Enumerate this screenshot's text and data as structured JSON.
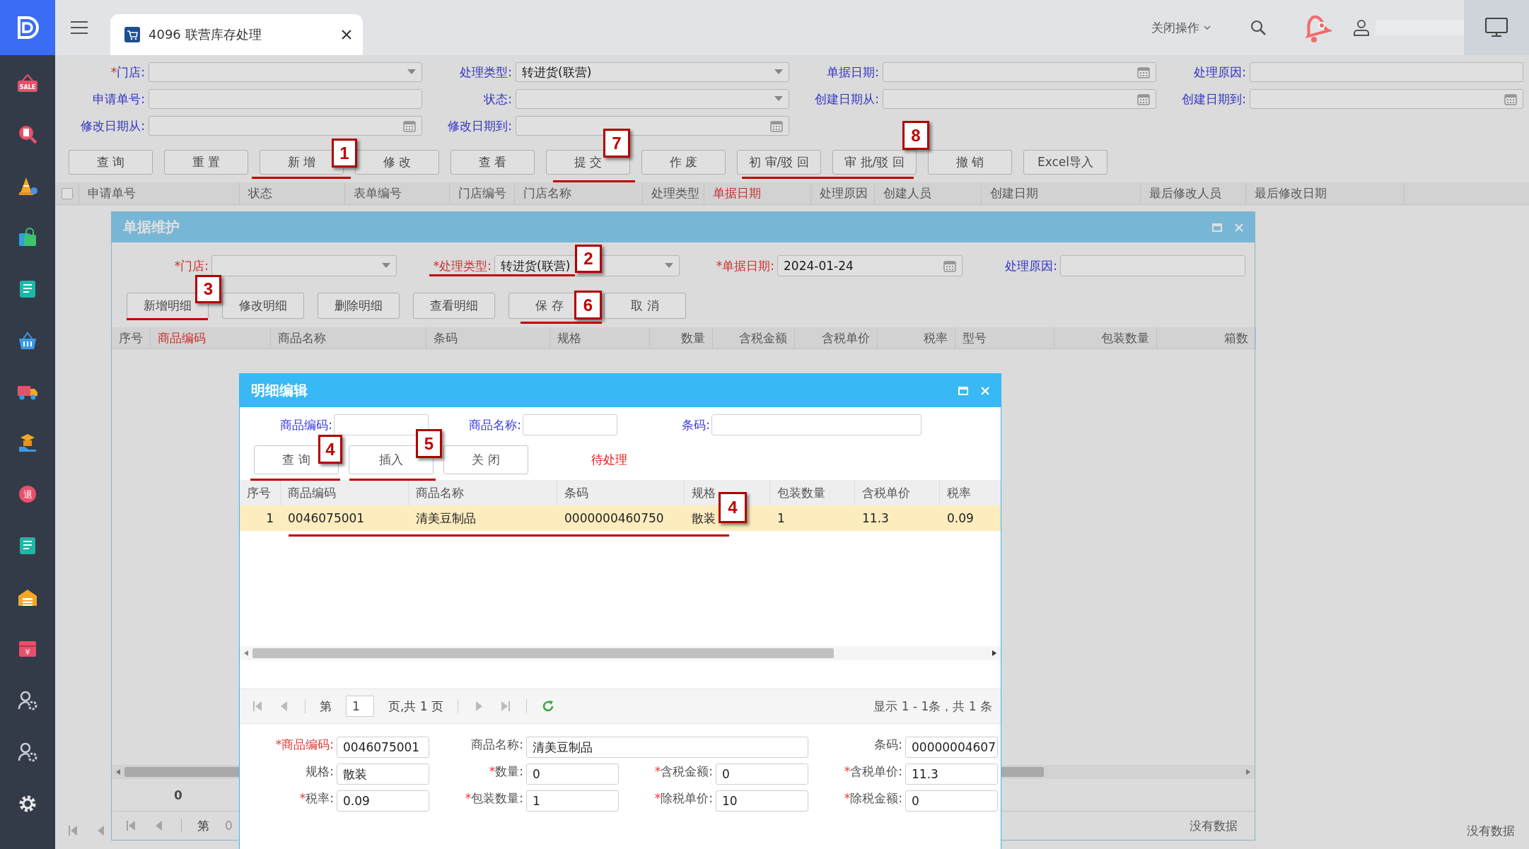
{
  "sidebar": [
    {
      "kind": "sale",
      "glyph": "SALE"
    },
    {
      "kind": "search-doc"
    },
    {
      "kind": "cone"
    },
    {
      "kind": "bag"
    },
    {
      "kind": "book"
    },
    {
      "kind": "basket"
    },
    {
      "kind": "truck"
    },
    {
      "kind": "hand-box"
    },
    {
      "kind": "badge",
      "glyph": "退"
    },
    {
      "kind": "book"
    },
    {
      "kind": "house"
    },
    {
      "kind": "money-box",
      "glyph": "¥"
    },
    {
      "kind": "user-gear"
    },
    {
      "kind": "user-gear"
    },
    {
      "kind": "gear"
    }
  ],
  "header": {
    "tab_title": "4096 联营库存处理",
    "close_menu": "关闭操作"
  },
  "filters": [
    {
      "label": "门店:",
      "mark": "*",
      "alert": false,
      "accent": true,
      "kind": "select"
    },
    {
      "label": "处理类型:",
      "alert": false,
      "accent": true,
      "kind": "select",
      "value": "转进货(联营)"
    },
    {
      "label": "单据日期:",
      "alert": false,
      "accent": true,
      "kind": "date"
    },
    {
      "label": "处理原因:",
      "alert": false,
      "accent": true,
      "kind": "text"
    },
    {
      "label": "申请单号:",
      "alert": false,
      "accent": true,
      "kind": "text"
    },
    {
      "label": "状态:",
      "alert": false,
      "accent": true,
      "kind": "select"
    },
    {
      "label": "创建日期从:",
      "alert": false,
      "accent": true,
      "kind": "date"
    },
    {
      "label": "创建日期到:",
      "alert": false,
      "accent": true,
      "kind": "date"
    },
    {
      "label": "修改日期从:",
      "alert": false,
      "accent": true,
      "kind": "date"
    },
    {
      "label": "修改日期到:",
      "alert": false,
      "accent": true,
      "kind": "date"
    }
  ],
  "toolbar": [
    "查 询",
    "重 置",
    "新 增",
    "修 改",
    "查 看",
    "提 交",
    "作 废",
    "初 审/驳 回",
    "审 批/驳 回",
    "撤 销",
    "Excel导入"
  ],
  "table": {
    "select_all": {
      "checked": false
    },
    "columns": [
      {
        "label": "申请单号",
        "highlight": false
      },
      {
        "label": "状态",
        "highlight": false
      },
      {
        "label": "表单编号",
        "highlight": false
      },
      {
        "label": "门店编号",
        "highlight": false
      },
      {
        "label": "门店名称",
        "highlight": false
      },
      {
        "label": "处理类型",
        "highlight": false
      },
      {
        "label": "单据日期",
        "highlight": true
      },
      {
        "label": "处理原因",
        "highlight": false
      },
      {
        "label": "创建人员",
        "highlight": false
      },
      {
        "label": "创建日期",
        "highlight": false
      },
      {
        "label": "最后修改人员",
        "highlight": false
      },
      {
        "label": "最后修改日期",
        "highlight": false
      }
    ]
  },
  "pager": {
    "empty_text": "没有数据"
  },
  "order_dialog": {
    "title": "单据维护",
    "fields": [
      {
        "label": "门店:",
        "mark": "*",
        "alert": true,
        "kind": "select"
      },
      {
        "label": "处理类型:",
        "mark": "*",
        "alert": true,
        "kind": "select",
        "value": "转进货(联营)"
      },
      {
        "label": "单据日期:",
        "mark": "*",
        "alert": true,
        "kind": "date",
        "value": "2024-01-24"
      },
      {
        "label": "处理原因:",
        "alert": false,
        "accent": true,
        "kind": "text"
      }
    ],
    "buttons": [
      "新增明细",
      "修改明细",
      "删除明细",
      "查看明细",
      "保 存",
      "取 消"
    ],
    "columns": [
      {
        "label": "序号",
        "highlight": false
      },
      {
        "label": "商品编码",
        "highlight": true
      },
      {
        "label": "商品名称",
        "highlight": false
      },
      {
        "label": "条码",
        "highlight": false
      },
      {
        "label": "规格",
        "highlight": false
      },
      {
        "label": "数量",
        "highlight": false
      },
      {
        "label": "含税金额",
        "highlight": false
      },
      {
        "label": "含税单价",
        "highlight": false
      },
      {
        "label": "税率",
        "highlight": false
      },
      {
        "label": "型号",
        "highlight": false
      },
      {
        "label": "包装数量",
        "highlight": false
      },
      {
        "label": "箱数",
        "highlight": false
      }
    ],
    "summary_value": "0",
    "pager": {
      "page_label": "第",
      "page": "0",
      "empty_text": "没有数据"
    }
  },
  "detail_dialog": {
    "title": "明细编辑",
    "search": [
      {
        "label": "商品编码:",
        "alert": false,
        "accent": true,
        "kind": "text"
      },
      {
        "label": "商品名称:",
        "alert": false,
        "accent": true,
        "kind": "text"
      },
      {
        "label": "条码:",
        "alert": false,
        "accent": true,
        "kind": "text"
      }
    ],
    "buttons": [
      "查 询",
      "插入",
      "关 闭"
    ],
    "status": "待处理",
    "columns": [
      "序号",
      "商品编码",
      "商品名称",
      "条码",
      "规格",
      "包装数量",
      "含税单价",
      "税率"
    ],
    "rows": [
      {
        "selected": true,
        "cells": [
          "1",
          "0046075001",
          "清美豆制品",
          "0000000460750",
          "散装",
          "1",
          "11.3",
          "0.09"
        ]
      }
    ],
    "pager": {
      "page_label": "第",
      "page": "1",
      "page_total": "页,共 1 页",
      "summary": "显示 1 - 1条，共 1 条"
    },
    "form": [
      {
        "label": "商品编码:",
        "mark": "*",
        "alert": true,
        "kind": "text",
        "value": "0046075001"
      },
      {
        "label": "商品名称:",
        "alert": false,
        "accent": false,
        "kind": "text",
        "value": "清美豆制品"
      },
      {
        "label": "条码:",
        "alert": false,
        "accent": false,
        "kind": "text",
        "value": "00000004607"
      },
      {
        "label": "规格:",
        "alert": false,
        "accent": false,
        "kind": "text",
        "value": "散装"
      },
      {
        "label": "数量:",
        "mark": "*",
        "alert": false,
        "accent": false,
        "kind": "text",
        "value": "0"
      },
      {
        "label": "含税金额:",
        "mark": "*",
        "alert": false,
        "accent": false,
        "kind": "text",
        "value": "0"
      },
      {
        "label": "含税单价:",
        "mark": "*",
        "alert": false,
        "accent": false,
        "kind": "text",
        "value": "11.3"
      },
      {
        "label": "税率:",
        "mark": "*",
        "alert": false,
        "accent": false,
        "kind": "text",
        "value": "0.09"
      },
      {
        "label": "包装数量:",
        "mark": "*",
        "alert": false,
        "accent": false,
        "kind": "text",
        "value": "1"
      },
      {
        "label": "除税单价:",
        "mark": "*",
        "alert": false,
        "accent": false,
        "kind": "text",
        "value": "10"
      },
      {
        "label": "除税金额:",
        "mark": "*",
        "alert": false,
        "accent": false,
        "kind": "text",
        "value": "0"
      }
    ]
  },
  "callouts": [
    {
      "number": "1"
    },
    {
      "number": "7"
    },
    {
      "number": "8"
    },
    {
      "number": "2"
    },
    {
      "number": "3"
    },
    {
      "number": "6"
    },
    {
      "number": "4"
    },
    {
      "number": "5"
    },
    {
      "number": "4"
    }
  ]
}
